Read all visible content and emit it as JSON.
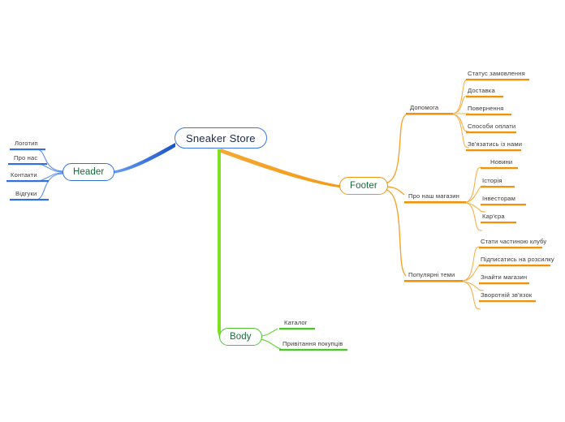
{
  "diagram": {
    "type": "mind-map",
    "root": {
      "label": "Sneaker Store",
      "color": "#3b74e8"
    },
    "branches": [
      {
        "id": "header",
        "label": "Header",
        "color": "#2f6fe0",
        "side": "left",
        "children": [
          {
            "label": "Логотип"
          },
          {
            "label": "Про нас"
          },
          {
            "label": "Контакти"
          },
          {
            "label": "Відгуки"
          }
        ]
      },
      {
        "id": "footer",
        "label": "Footer",
        "color": "#f1930e",
        "side": "right",
        "children": [
          {
            "label": "Допомога",
            "children": [
              {
                "label": "Статус замовлення"
              },
              {
                "label": "Доставка"
              },
              {
                "label": "Повернення"
              },
              {
                "label": "Способи оплати"
              },
              {
                "label": "Зв'язатись із нами"
              }
            ]
          },
          {
            "label": "Про наш магазин",
            "children": [
              {
                "label": "Новини"
              },
              {
                "label": "Історія"
              },
              {
                "label": "Інвесторам"
              },
              {
                "label": "Кар'єра"
              }
            ]
          },
          {
            "label": "Популярні теми",
            "children": [
              {
                "label": "Стати частиною клубу"
              },
              {
                "label": "Підписатись на розсилку"
              },
              {
                "label": "Знайти магазин"
              },
              {
                "label": "Зворотній зв'язок"
              }
            ]
          }
        ]
      },
      {
        "id": "body",
        "label": "Body",
        "color": "#4ec52b",
        "side": "bottom",
        "children": [
          {
            "label": "Каталог"
          },
          {
            "label": "Привітання покупців"
          }
        ]
      }
    ]
  }
}
